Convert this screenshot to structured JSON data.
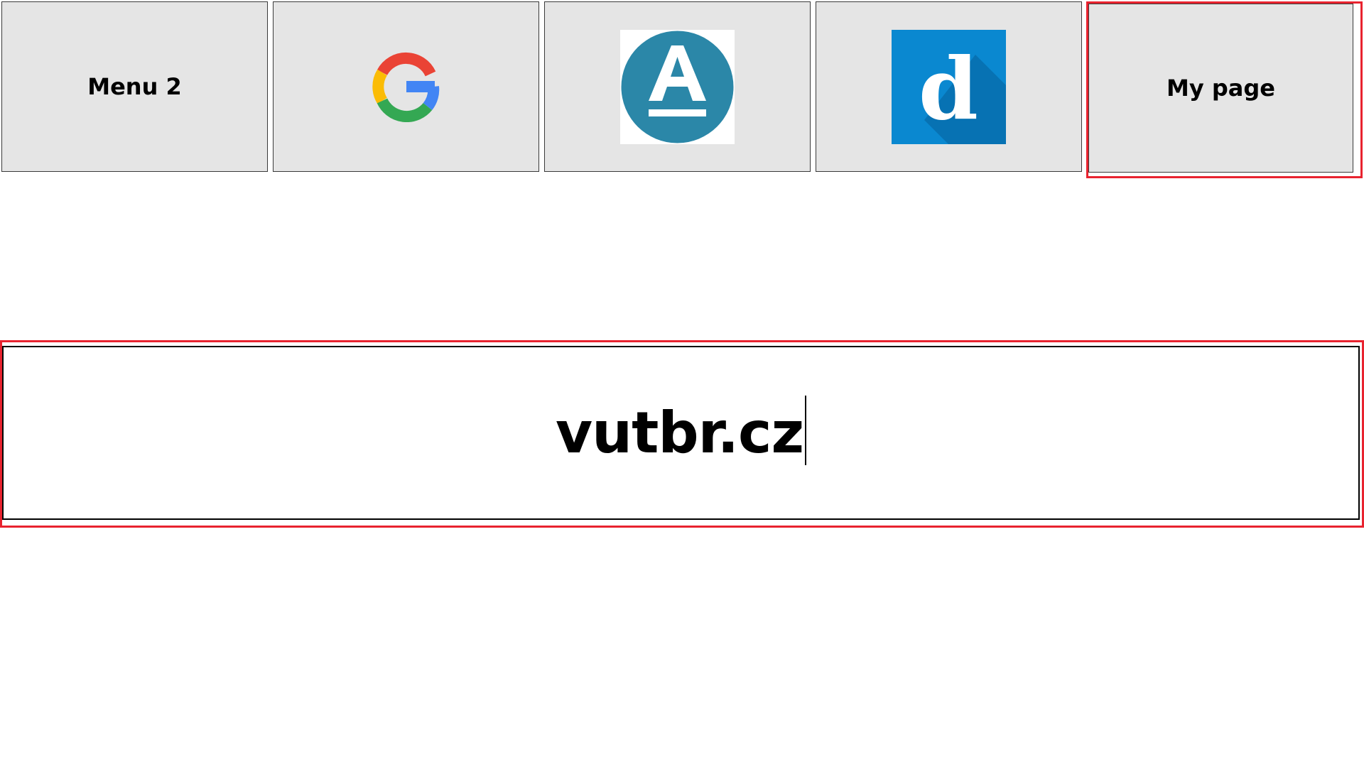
{
  "menu": {
    "tiles": [
      {
        "label": "Menu 2"
      },
      {
        "icon": "google-logo-icon"
      },
      {
        "icon": "letter-a-circle-logo-icon",
        "color": "#2b87a8"
      },
      {
        "icon": "letter-d-logo-icon",
        "color": "#0a88d0"
      },
      {
        "label": "My page"
      }
    ]
  },
  "input": {
    "value": "vutbr.cz"
  },
  "colors": {
    "tile_bg": "#e5e5e5",
    "highlight": "#e8232f"
  }
}
